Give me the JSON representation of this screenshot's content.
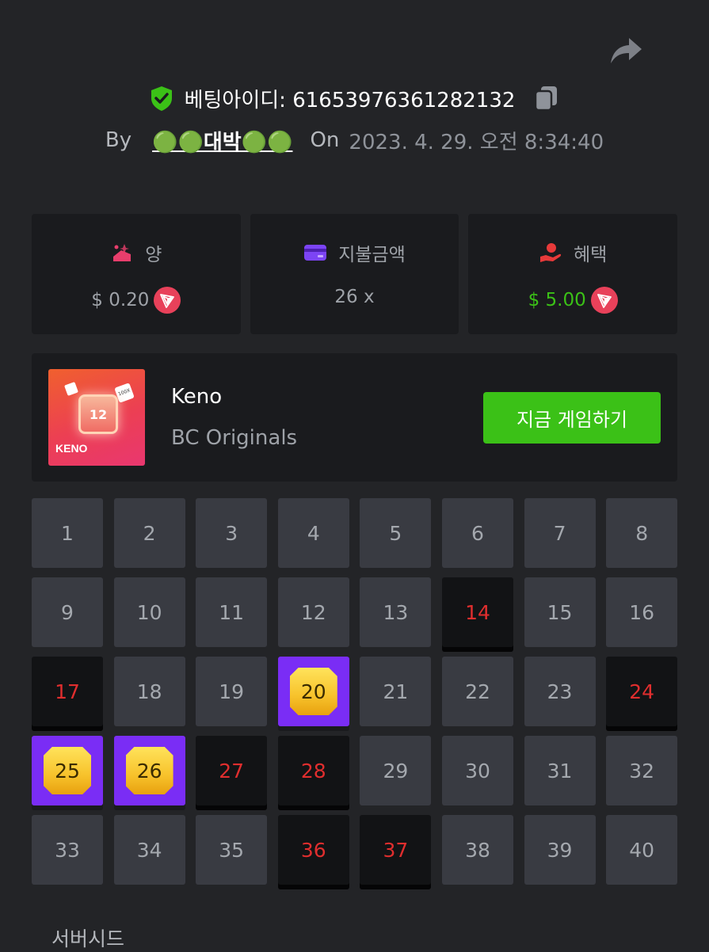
{
  "header": {
    "bet_id_label": "베팅아이디: 61653976361282132",
    "by_label": "By",
    "username": "🟢🟢대박🟢🟢",
    "on_label": "On",
    "date": "2023. 4. 29. 오전 8:34:40"
  },
  "stats": [
    {
      "label": "양",
      "value": "$ 0.20",
      "has_coin": true,
      "value_color": "#9ea2a8"
    },
    {
      "label": "지불금액",
      "value": "26 x",
      "has_coin": false,
      "value_color": "#9ea2a8"
    },
    {
      "label": "혜택",
      "value": "$ 5.00",
      "has_coin": true,
      "value_color": "#3bc117"
    }
  ],
  "game": {
    "name": "Keno",
    "provider": "BC Originals",
    "play_label": "지금 게임하기",
    "thumb_number": "12",
    "thumb_badge": "100X",
    "thumb_title": "KENO"
  },
  "board": {
    "numbers": [
      1,
      2,
      3,
      4,
      5,
      6,
      7,
      8,
      9,
      10,
      11,
      12,
      13,
      14,
      15,
      16,
      17,
      18,
      19,
      20,
      21,
      22,
      23,
      24,
      25,
      26,
      27,
      28,
      29,
      30,
      31,
      32,
      33,
      34,
      35,
      36,
      37,
      38,
      39,
      40
    ],
    "hits": [
      20,
      25,
      26
    ],
    "misses": [
      14,
      17,
      24,
      27,
      28,
      36,
      37
    ]
  },
  "footer": {
    "server_seed_label": "서버시드"
  },
  "colors": {
    "accent_green": "#3bc117",
    "hit_purple": "#7a2df5",
    "miss_red": "#e02e2e",
    "coin_red": "#e8415a"
  }
}
